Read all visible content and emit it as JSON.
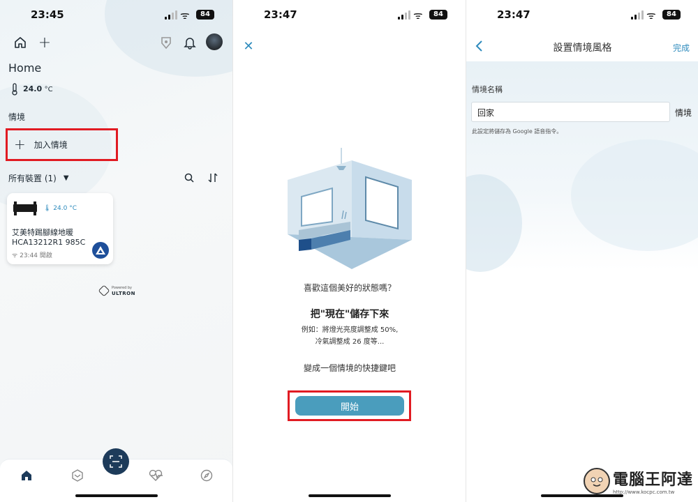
{
  "panel1": {
    "status": {
      "time": "23:45",
      "battery": "84"
    },
    "home_title": "Home",
    "temperature": {
      "value": "24.0",
      "unit": "°C"
    },
    "scenes_title": "情境",
    "add_scene_label": "加入情境",
    "devices_header": "所有裝置 (1)",
    "device": {
      "temp": "24.0 °C",
      "name": "艾美特踢腳線地暖",
      "model": "HCA13212R1 985C",
      "status": "23:44 開啟"
    },
    "powered_by": "Powered by",
    "brand": "ULTRON"
  },
  "panel2": {
    "status": {
      "time": "23:47",
      "battery": "84"
    },
    "question": "喜歡這個美好的狀態嗎？",
    "headline": "把\"現在\"儲存下來",
    "example_line1": "例如：將燈光亮度調整成 50%,",
    "example_line2": "冷氣調整成 26 度等...",
    "shortcut_text": "變成一個情境的快捷鍵吧",
    "start_button": "開始"
  },
  "panel3": {
    "status": {
      "time": "23:47",
      "battery": "84"
    },
    "title": "設置情境風格",
    "done_label": "完成",
    "field_label": "情境名稱",
    "field_value": "回家",
    "side_label": "情境",
    "hint": "此設定將儲存為 Google 語音指令。"
  },
  "watermark": {
    "text": "電腦王阿達",
    "url": "http://www.kocpc.com.tw"
  },
  "colors": {
    "accent": "#4a9dbd",
    "highlight": "#e11b22",
    "link": "#2e8bbd"
  }
}
